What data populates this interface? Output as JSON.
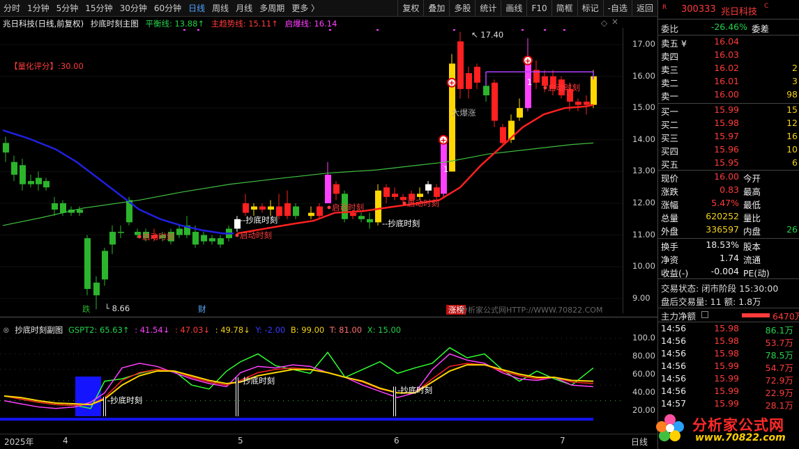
{
  "toolbar": {
    "periods": [
      "分时",
      "1分钟",
      "5分钟",
      "15分钟",
      "30分钟",
      "60分钟",
      "日线",
      "周线",
      "月线",
      "多周期",
      "更多 〉"
    ],
    "active_period": "日线",
    "tools": [
      "复权",
      "叠加",
      "多股",
      "统计",
      "画线",
      "F10",
      "简框",
      "标记",
      "-自选",
      "返回"
    ]
  },
  "main_chart": {
    "stock_label": "兆日科技(日线,前复权)",
    "indicator_name": "抄底时刻主图",
    "ping_heng": "平衡线: 13.88↑",
    "zhu_qu_shi": "主趋势线: 15.11↑",
    "qi_bao": "启爆线: 16.14",
    "score_label": "【量化评分】:30.00",
    "high_label": "17.40",
    "low_label": "8.66",
    "events": [
      "跌",
      "财",
      "涨榜"
    ],
    "annotations": {
      "chaodi": "抄底时刻",
      "qidong": "启动时刻",
      "baozhang": "大爆涨"
    },
    "y_ticks": [
      "17.00",
      "16.00",
      "15.00",
      "14.00",
      "13.00",
      "12.00",
      "11.00",
      "10.00",
      "9.00"
    ],
    "colors": {
      "up": "#ff2020",
      "down": "#2cb52c",
      "blue_ma": "#2020e0",
      "red_ma": "#ff2020",
      "green_ma": "#40c040",
      "yellow": "#ffd700",
      "magenta": "#ff40ff"
    }
  },
  "sub_chart": {
    "name": "抄底时刻副图",
    "gspt2": "GSPT2: 65.63↑",
    "v1": ": 41.54↓",
    "v2": ": 47.03↓",
    "v3": ": 49.78↓",
    "y": "Y: -2.00",
    "b": "B: 99.00",
    "t": "T: 81.00",
    "x": "X: 15.00",
    "y_ticks": [
      "100.0",
      "80.00",
      "60.00",
      "40.00",
      "20.00"
    ],
    "annotation": "抄底时刻"
  },
  "x_axis": {
    "labels": [
      "2025年",
      "4",
      "5",
      "6",
      "7"
    ],
    "period": "日线"
  },
  "watermark": "分析家公式网HTTP://WWW.70822.COM",
  "right_panel": {
    "code": "300333",
    "name": "兆日科技",
    "r_badge": "R",
    "c_badge": "C",
    "weibi_label": "委比",
    "weibi": "-26.46%",
    "weicha_label": "委差",
    "asks": [
      {
        "label": "卖五 ¥",
        "price": "16.04",
        "vol": ""
      },
      {
        "label": "卖四",
        "price": "16.03",
        "vol": ""
      },
      {
        "label": "卖三",
        "price": "16.02",
        "vol": "2"
      },
      {
        "label": "卖二",
        "price": "16.01",
        "vol": "3"
      },
      {
        "label": "卖一",
        "price": "16.00",
        "vol": "98"
      }
    ],
    "bids": [
      {
        "label": "买一",
        "price": "15.99",
        "vol": "15"
      },
      {
        "label": "买二",
        "price": "15.98",
        "vol": "12"
      },
      {
        "label": "买三",
        "price": "15.97",
        "vol": "16"
      },
      {
        "label": "买四",
        "price": "15.96",
        "vol": "10"
      },
      {
        "label": "买五",
        "price": "15.95",
        "vol": "6"
      }
    ],
    "quote": [
      {
        "l1": "现价",
        "v1": "16.00",
        "l2": "今开"
      },
      {
        "l1": "涨跌",
        "v1": "0.83",
        "l2": "最高"
      },
      {
        "l1": "涨幅",
        "v1": "5.47%",
        "l2": "最低"
      },
      {
        "l1": "总量",
        "v1": "620252",
        "l2": "量比"
      },
      {
        "l1": "外盘",
        "v1": "336597",
        "l2": "内盘",
        "v2": "26"
      }
    ],
    "stats": [
      {
        "l1": "换手",
        "v1": "18.53%",
        "l2": "股本"
      },
      {
        "l1": "净资",
        "v1": "1.74",
        "l2": "流通"
      },
      {
        "l1": "收益(-)",
        "v1": "-0.004",
        "l2": "PE(动)"
      }
    ],
    "trade_status": "交易状态: 闭市阶段 15:30:00",
    "after_hours": "盘后交易量: 11  额: 1.8万",
    "net_label": "主力净额",
    "net_value": "6470万",
    "ticks": [
      {
        "t": "14:56",
        "p": "15.98",
        "v": "86.1万",
        "c": "green"
      },
      {
        "t": "14:56",
        "p": "15.98",
        "v": "53.7万",
        "c": "red"
      },
      {
        "t": "14:56",
        "p": "15.98",
        "v": "78.5万",
        "c": "green"
      },
      {
        "t": "14:56",
        "p": "15.99",
        "v": "54.7万",
        "c": "red"
      },
      {
        "t": "14:56",
        "p": "15.99",
        "v": "72.9万",
        "c": "red"
      },
      {
        "t": "14:56",
        "p": "15.99",
        "v": "22.9万",
        "c": "red"
      },
      {
        "t": "14:57",
        "p": "15.99",
        "v": "28.1万",
        "c": "red"
      }
    ]
  },
  "logo": {
    "text": "分析家公式网",
    "url": "www.70822.com"
  }
}
